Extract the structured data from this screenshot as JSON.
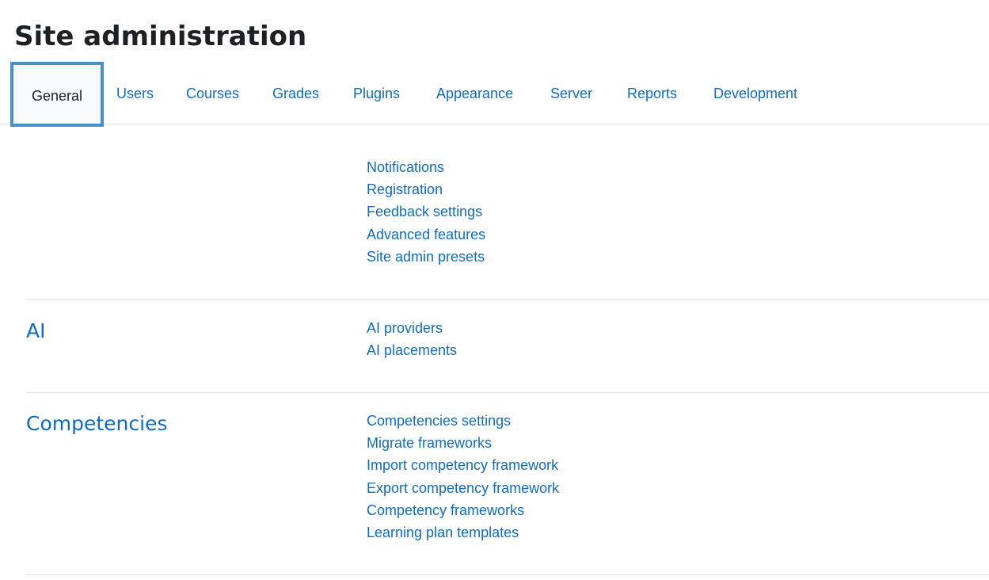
{
  "page": {
    "title": "Site administration"
  },
  "tabs": [
    {
      "label": "General",
      "active": true
    },
    {
      "label": "Users",
      "active": false
    },
    {
      "label": "Courses",
      "active": false
    },
    {
      "label": "Grades",
      "active": false
    },
    {
      "label": "Plugins",
      "active": false
    },
    {
      "label": "Appearance",
      "active": false
    },
    {
      "label": "Server",
      "active": false
    },
    {
      "label": "Reports",
      "active": false
    },
    {
      "label": "Development",
      "active": false
    }
  ],
  "sections": {
    "general": {
      "links": [
        "Notifications",
        "Registration",
        "Feedback settings",
        "Advanced features",
        "Site admin presets"
      ]
    },
    "ai": {
      "heading": "AI",
      "links": [
        "AI providers",
        "AI placements"
      ]
    },
    "competencies": {
      "heading": "Competencies",
      "links": [
        "Competencies settings",
        "Migrate frameworks",
        "Import competency framework",
        "Export competency framework",
        "Competency frameworks",
        "Learning plan templates"
      ]
    }
  },
  "colors": {
    "link": "#0f6cbf",
    "text": "#1d2125",
    "active_tab_border": "#4a90c8",
    "divider": "#dee2e6"
  }
}
